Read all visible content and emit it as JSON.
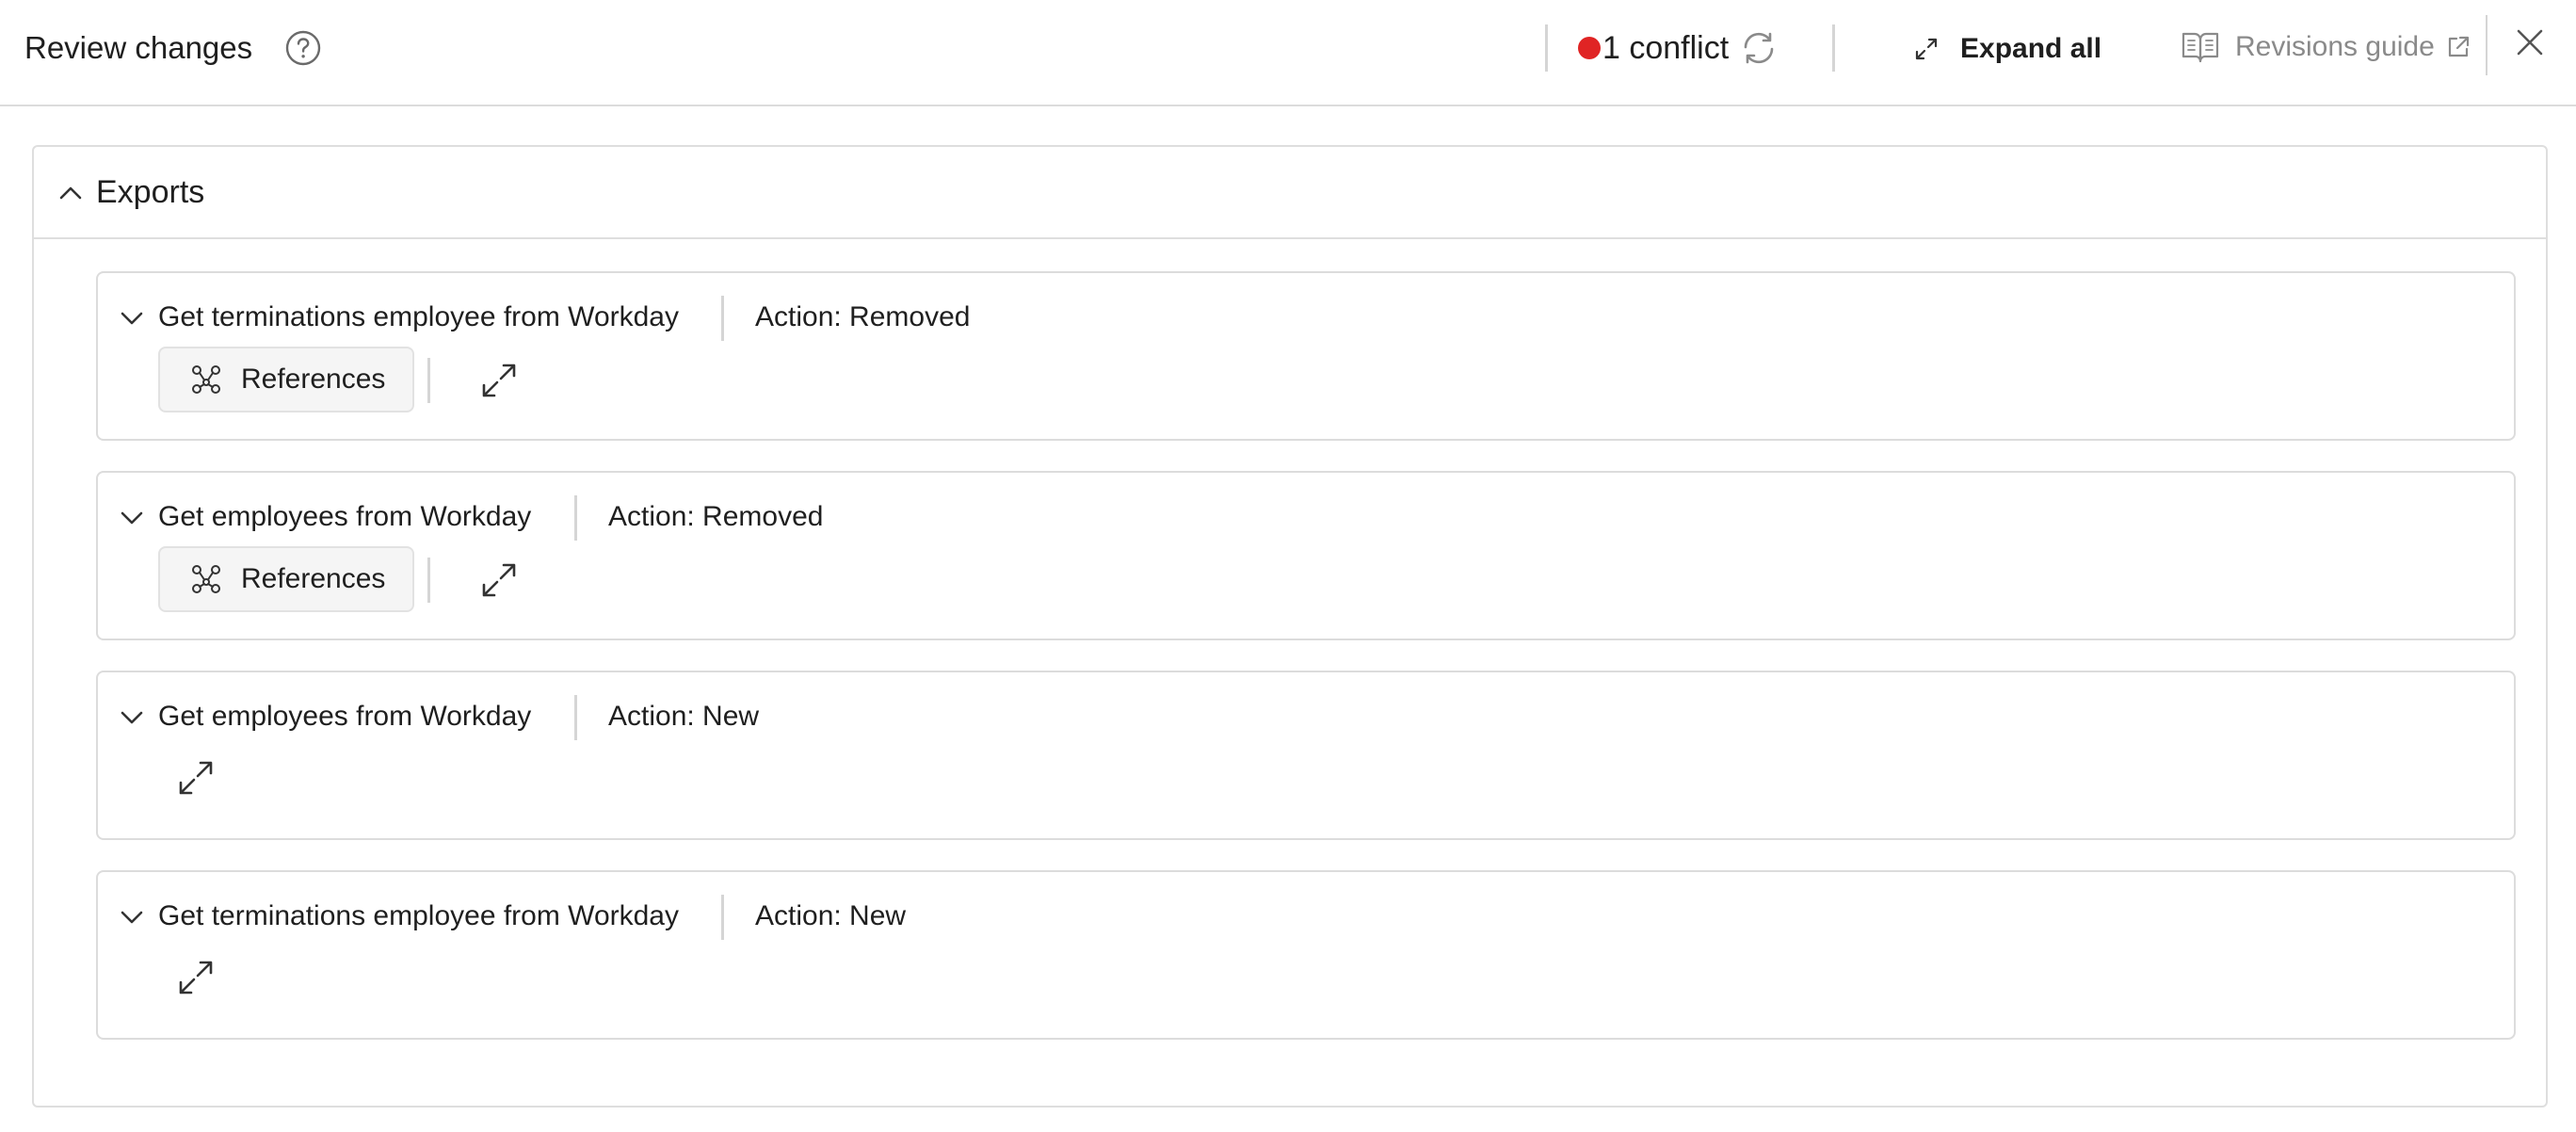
{
  "header": {
    "title": "Review changes",
    "conflict_label": "1 conflict",
    "conflict_color": "#e02424",
    "expand_all_label": "Expand all",
    "guide_label": "Revisions guide"
  },
  "section": {
    "title": "Exports",
    "items": [
      {
        "name": "Get terminations employee from Workday",
        "action": "Action: Removed",
        "references_label": "References"
      },
      {
        "name": "Get employees from Workday",
        "action": "Action: Removed",
        "references_label": "References"
      },
      {
        "name": "Get employees from Workday",
        "action": "Action: New"
      },
      {
        "name": "Get terminations employee from Workday",
        "action": "Action: New"
      }
    ]
  },
  "icons": {
    "help": "question-circle-icon",
    "refresh": "refresh-icon",
    "expand": "expand-arrows-icon",
    "guide": "open-book-icon",
    "external": "external-link-icon",
    "close": "close-icon",
    "collapse": "chevron-up-icon",
    "expand_item": "chevron-down-icon",
    "references": "graph-nodes-icon"
  }
}
